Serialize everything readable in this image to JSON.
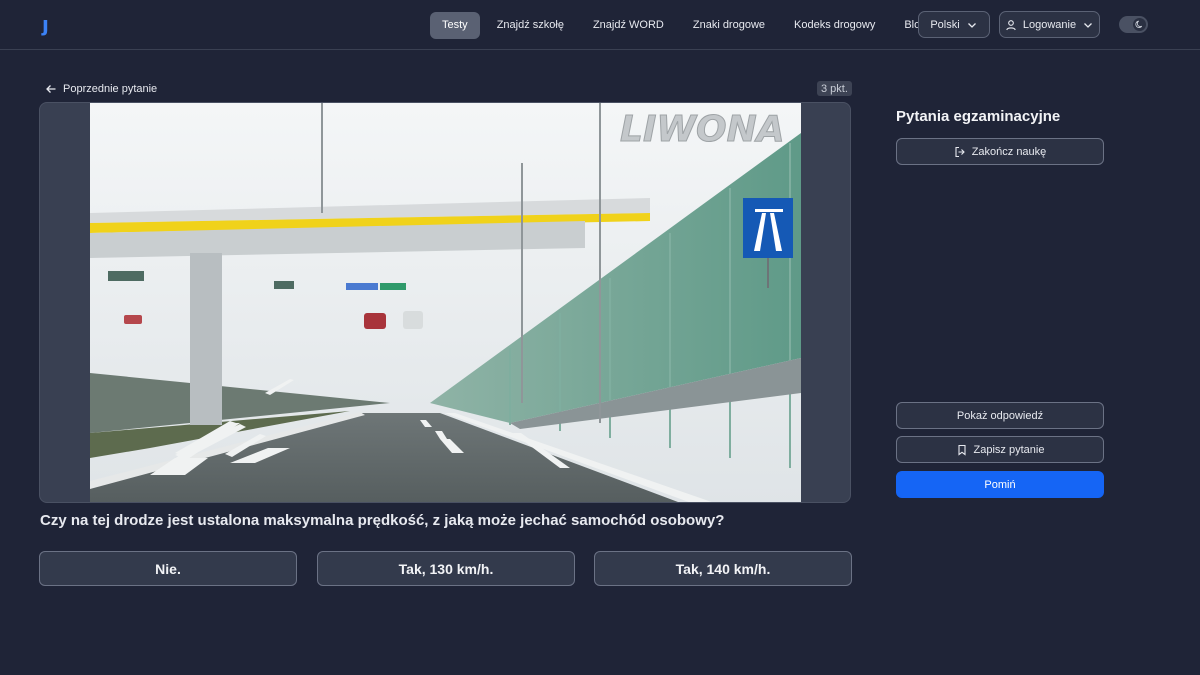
{
  "header": {
    "logo": "jazda",
    "nav": [
      {
        "label": "Testy",
        "active": true
      },
      {
        "label": "Znajdź szkołę",
        "active": false
      },
      {
        "label": "Znajdź WORD",
        "active": false
      },
      {
        "label": "Znaki drogowe",
        "active": false
      },
      {
        "label": "Kodeks drogowy",
        "active": false
      },
      {
        "label": "Blog",
        "active": false
      }
    ],
    "language_label": "Polski",
    "login_label": "Logowanie",
    "theme_icon": "moon-icon"
  },
  "question": {
    "back_label": "Poprzednie pytanie",
    "points_badge": "3 pkt.",
    "watermark": "LIWONA",
    "text": "Czy na tej drodze jest ustalona maksymalna prędkość, z jaką może jechać samochód osobowy?",
    "answers": [
      "Nie.",
      "Tak, 130 km/h.",
      "Tak, 140 km/h."
    ]
  },
  "sidebar": {
    "title": "Pytania egzaminacyjne",
    "end_label": "Zakończ naukę",
    "show_answer_label": "Pokaż odpowiedź",
    "save_label": "Zapisz pytanie",
    "skip_label": "Pomiń"
  },
  "colors": {
    "background": "#1f2437",
    "primary": "#1565f5",
    "logo_accent": "#3b82f6"
  }
}
